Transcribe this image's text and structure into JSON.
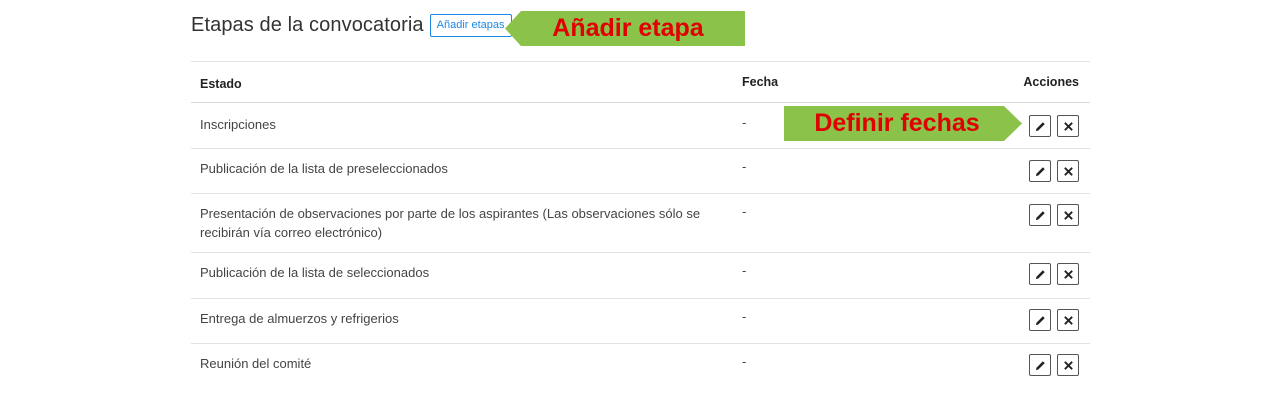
{
  "header": {
    "title": "Etapas de la convocatoria",
    "add_button": "Añadir etapas"
  },
  "table": {
    "columns": [
      "Estado",
      "Fecha",
      "Acciones"
    ],
    "rows": [
      {
        "estado": "Inscripciones",
        "fecha": "-"
      },
      {
        "estado": "Publicación de la lista de preseleccionados",
        "fecha": "-"
      },
      {
        "estado": "Presentación de observaciones por parte de los aspirantes (Las observaciones sólo se recibirán vía correo electrónico)",
        "fecha": "-"
      },
      {
        "estado": "Publicación de la lista de seleccionados",
        "fecha": "-"
      },
      {
        "estado": "Entrega de almuerzos y refrigerios",
        "fecha": "-"
      },
      {
        "estado": "Reunión del comité",
        "fecha": "-"
      }
    ],
    "row_actions": {
      "edit_icon": "pencil-icon",
      "delete_icon": "close-icon"
    }
  },
  "callouts": {
    "add_stage": "Añadir etapa",
    "define_dates": "Definir fechas"
  },
  "colors": {
    "accent": "#1e88e5",
    "callout_bg": "#8bc34a",
    "callout_text": "#e00000"
  }
}
